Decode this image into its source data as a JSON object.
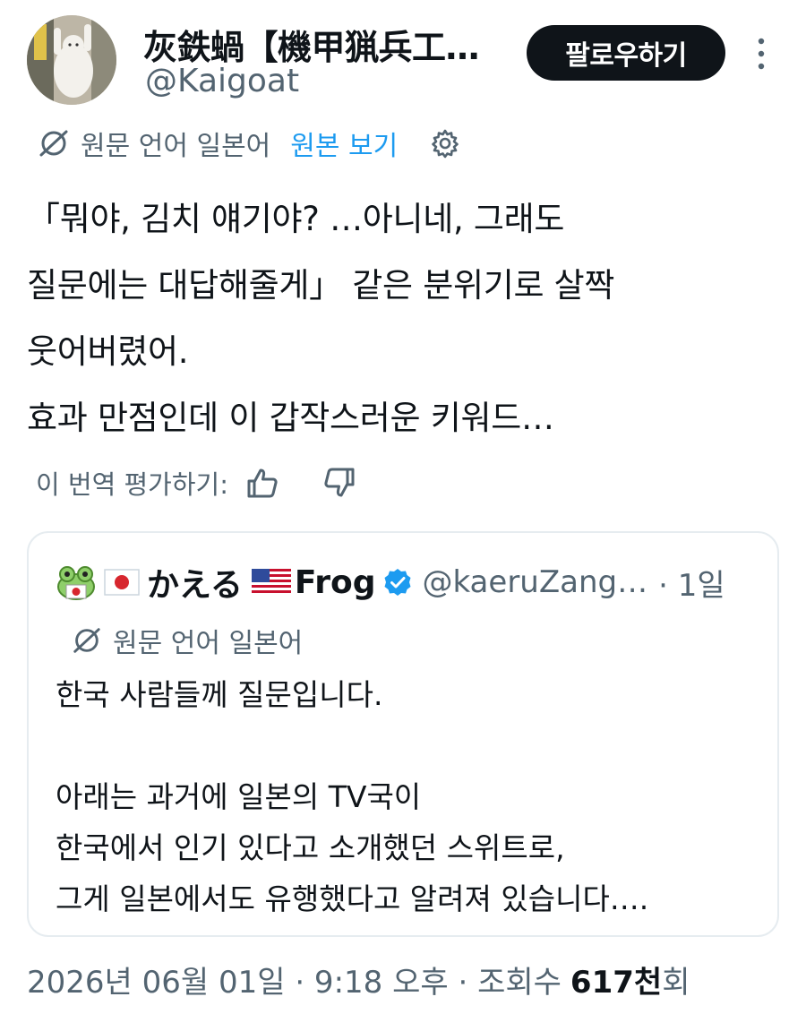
{
  "author": {
    "display_name": "灰鉄蝸【機甲猟兵工…",
    "handle": "@Kaigoat"
  },
  "follow_button": {
    "label": "팔로우하기"
  },
  "translation": {
    "label": "원문 언어 일본어",
    "show_original": "원본 보기"
  },
  "tweet": {
    "lines": [
      "「뭐야, 김치 얘기야? …아니네, 그래도",
      "질문에는 대답해줄게」 같은 분위기로 살짝",
      "웃어버렸어.",
      "효과 만점인데 이 갑작스러운 키워드…"
    ]
  },
  "rate": {
    "label": "이 번역 평가하기:"
  },
  "quote": {
    "name_jp": "かえる",
    "name_en": "Frog",
    "handle": "@kaeruZang…",
    "time": "· 1일",
    "translation_label": "원문 언어 일본어",
    "lines": [
      "한국 사람들께 질문입니다.",
      "",
      "아래는 과거에 일본의 TV국이",
      "한국에서 인기 있다고 소개했던 스위트로,",
      "그게 일본에서도 유행했다고 알려져 있습니다…."
    ]
  },
  "meta": {
    "datetime": "2026년 06월 01일 · 9:18 오후 · 조회수",
    "views_count": "617천",
    "views_unit": "회"
  },
  "colors": {
    "text": "#0f1419",
    "secondary": "#536471",
    "accent": "#1d9bf0",
    "button_bg": "#0f1419",
    "border": "#e6ecf0"
  },
  "icons": {
    "more": "more-vertical-icon",
    "translate": "translate-globe-icon",
    "settings": "gear-icon",
    "thumbs_up": "thumbs-up-icon",
    "thumbs_down": "thumbs-down-icon",
    "verified": "verified-badge-icon"
  }
}
